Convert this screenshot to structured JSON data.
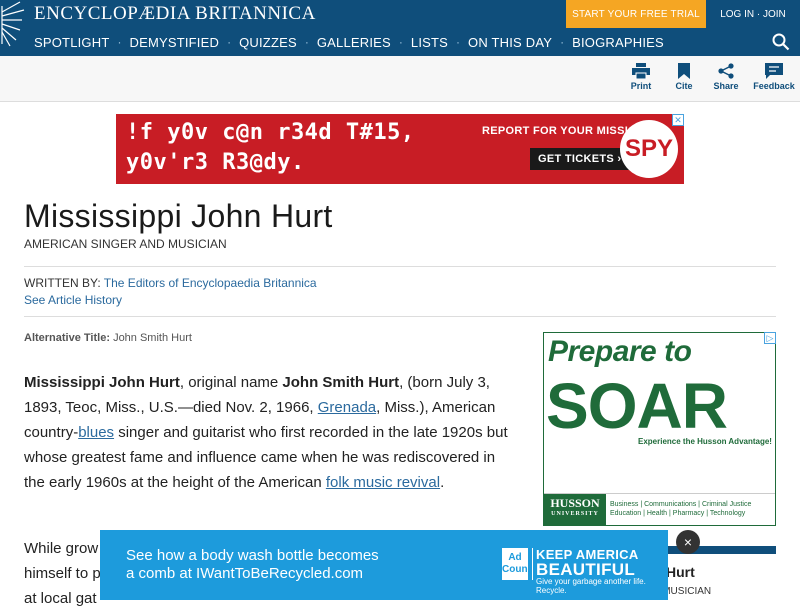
{
  "header": {
    "logo_text": "ENCYCLOPÆDIA BRITANNICA",
    "cta": "START YOUR FREE TRIAL",
    "login": "LOG IN · JOIN"
  },
  "nav": {
    "items": [
      "SPOTLIGHT",
      "DEMYSTIFIED",
      "QUIZZES",
      "GALLERIES",
      "LISTS",
      "ON THIS DAY",
      "BIOGRAPHIES"
    ],
    "separator": "·"
  },
  "toolbar": {
    "print": "Print",
    "cite": "Cite",
    "share": "Share",
    "feedback": "Feedback"
  },
  "ad_top": {
    "line1": "!f y0v c@n r34d T#15,",
    "line2": "y0v'r3 R3@dy.",
    "mission": "REPORT FOR YOUR MISSION",
    "button": "GET TICKETS ›",
    "brand": "SPY"
  },
  "article": {
    "title": "Mississippi John Hurt",
    "subtitle": "AMERICAN SINGER AND MUSICIAN",
    "written_label": "WRITTEN BY:",
    "written_by": "The Editors of Encyclopaedia Britannica",
    "history": "See Article History",
    "alt_label": "Alternative Title:",
    "alt_value": "John Smith Hurt",
    "p1": {
      "name": "Mississippi John Hurt",
      "t1": ", original name ",
      "orig": "John Smith Hurt",
      "t2": ", (born July 3, 1893, Teoc, Miss., U.S.—died Nov. 2, 1966, ",
      "link1": "Grenada",
      "t3": ", Miss.), American country-",
      "link2": "blues",
      "t4": " singer and guitarist who first recorded in the late 1920s but whose greatest fame and influence came when he was rediscovered in the early 1960s at the height of the American ",
      "link3": "folk music revival",
      "t5": "."
    },
    "p2_start": "While grow",
    "p2_line2": "himself to p",
    "p2_line3": "at local gat"
  },
  "ad_side": {
    "line1": "Prepare to",
    "line2": "SOAR",
    "experience": "Experience the Husson Advantage!",
    "school": "HUSSON",
    "school_sub": "UNIVERSITY",
    "fields_1": "Business | Communications | Criminal Justice",
    "fields_2": "Education | Health | Pharmacy | Technology"
  },
  "side_box": {
    "name": "hn Hurt",
    "role": "ND MUSICIAN"
  },
  "ad_bottom": {
    "text1": "See how a body wash bottle becomes",
    "text2": "a comb at IWantToBeRecycled.com",
    "ad_council": "Ad Council",
    "keep": "KEEP AMERICA",
    "beautiful": "BEAUTIFUL",
    "tagline": "Give your garbage another life. Recycle.",
    "close": "×"
  },
  "colors": {
    "brand_blue": "#0f4e7b",
    "cta_orange": "#f5a623",
    "link_blue": "#2b6a9e"
  }
}
